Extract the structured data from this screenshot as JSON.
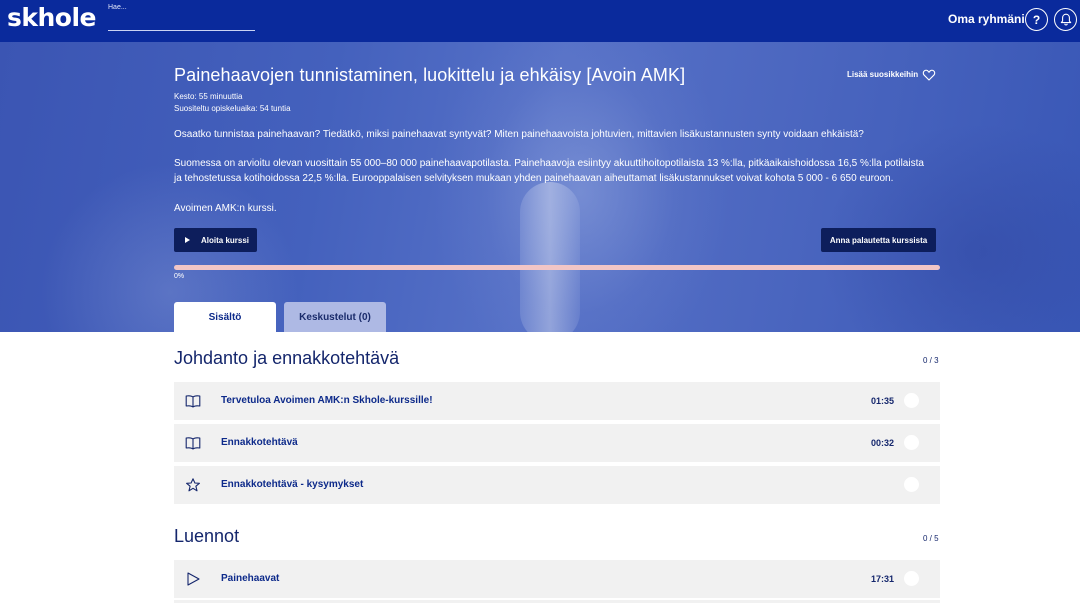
{
  "header": {
    "logo": "skhole",
    "search_label": "Hae...",
    "search_placeholder": "",
    "groups_link": "Oma ryhmäni",
    "help_label": "?"
  },
  "course": {
    "title": "Painehaavojen tunnistaminen, luokittelu ja ehkäisy [Avoin AMK]",
    "favorite_label": "Lisää suosikkeihin",
    "duration": "Kesto: 55 minuuttia",
    "study_time": "Suositeltu opiskeluaika: 54 tuntia",
    "description": [
      "Osaatko tunnistaa painehaavan? Tiedätkö, miksi painehaavat syntyvät? Miten painehaavoista johtuvien, mittavien lisäkustannusten synty voidaan ehkäistä?",
      "Suomessa on arvioitu olevan vuosittain 55 000–80 000 painehaavapotilasta. Painehaavoja esiintyy akuuttihoitopotilaista 13 %:lla, pitkäaikaishoidossa 16,5 %:lla potilaista ja tehostetussa kotihoidossa 22,5 %:lla. Eurooppalaisen selvityksen mukaan yhden painehaavan aiheuttamat lisäkustannukset voivat kohota 5 000 - 6 650 euroon.",
      "Avoimen AMK:n kurssi."
    ],
    "start_button": "Aloita kurssi",
    "feedback_button": "Anna palautetta kurssista",
    "progress_percent": 0,
    "progress_text": "0%"
  },
  "tabs": [
    {
      "label": "Sisältö",
      "active": true
    },
    {
      "label": "Keskustelut (0)",
      "active": false
    }
  ],
  "sections": [
    {
      "title": "Johdanto ja ennakkotehtävä",
      "count": "0 / 3",
      "items": [
        {
          "icon": "book-icon",
          "label": "Tervetuloa Avoimen AMK:n Skhole-kurssille!",
          "time": "01:35"
        },
        {
          "icon": "book-icon",
          "label": "Ennakkotehtävä",
          "time": "00:32"
        },
        {
          "icon": "star-icon",
          "label": "Ennakkotehtävä - kysymykset",
          "time": ""
        }
      ]
    },
    {
      "title": "Luennot",
      "count": "0 / 5",
      "items": [
        {
          "icon": "play-icon",
          "label": "Painehaavat",
          "time": "17:31"
        }
      ]
    }
  ],
  "colors": {
    "header_bg": "#0a2a9c",
    "dark_button": "#0d1e5c",
    "progress_track": "#f2c6c6",
    "row_bg": "#f1f1f1",
    "text_primary": "#14266c"
  }
}
